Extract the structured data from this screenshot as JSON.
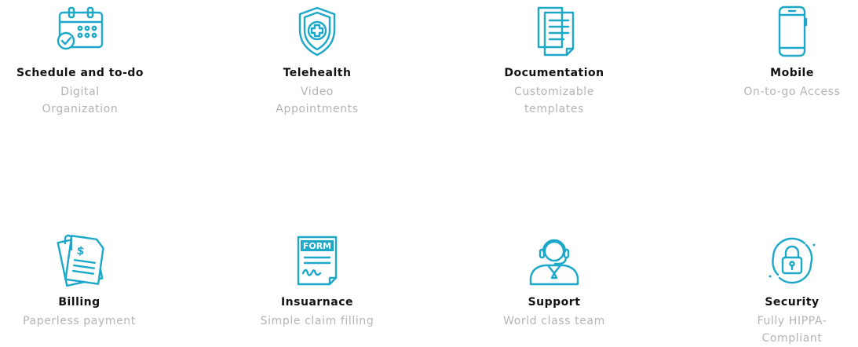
{
  "accent_color": "#1ba8c9",
  "features": [
    {
      "title": "Schedule and to-do",
      "description": "Digital Organization",
      "icon": "calendar-check-icon"
    },
    {
      "title": "Telehealth",
      "description": "Video Appointments",
      "icon": "medical-shield-icon"
    },
    {
      "title": "Documentation",
      "description": "Customizable templates",
      "icon": "documents-icon"
    },
    {
      "title": "Mobile",
      "description": "On-to-go Access",
      "icon": "smartphone-icon"
    },
    {
      "title": "Billing",
      "description": "Paperless payment",
      "icon": "invoice-icon"
    },
    {
      "title": "Insuarnace",
      "description": "Simple claim filling",
      "icon": "form-icon"
    },
    {
      "title": "Support",
      "description": "World class team",
      "icon": "headset-agent-icon"
    },
    {
      "title": "Security",
      "description": "Fully HIPPA-Compliant",
      "icon": "lock-icon"
    }
  ]
}
